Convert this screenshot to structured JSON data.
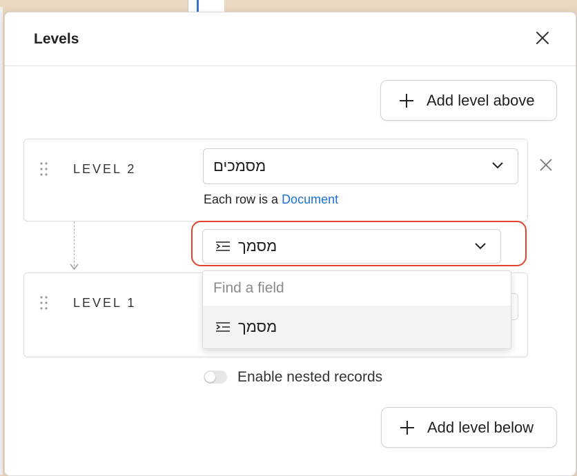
{
  "modal": {
    "title": "Levels",
    "add_above_label": "Add level above",
    "add_below_label": "Add level below"
  },
  "level2": {
    "label": "LEVEL 2",
    "selected_table": "מסמכים",
    "row_prefix": "Each row is a",
    "row_link": "Document"
  },
  "link_field": {
    "selected": "מסמך",
    "icon": "linked-record-icon"
  },
  "dropdown": {
    "search_placeholder": "Find a field",
    "options": [
      {
        "label": "מסמך",
        "icon": "linked-record-icon"
      }
    ]
  },
  "level1": {
    "label": "LEVEL 1"
  },
  "nested": {
    "label": "Enable nested records",
    "enabled": false
  },
  "colors": {
    "highlight": "#e4432d",
    "link": "#1a6fd3"
  }
}
